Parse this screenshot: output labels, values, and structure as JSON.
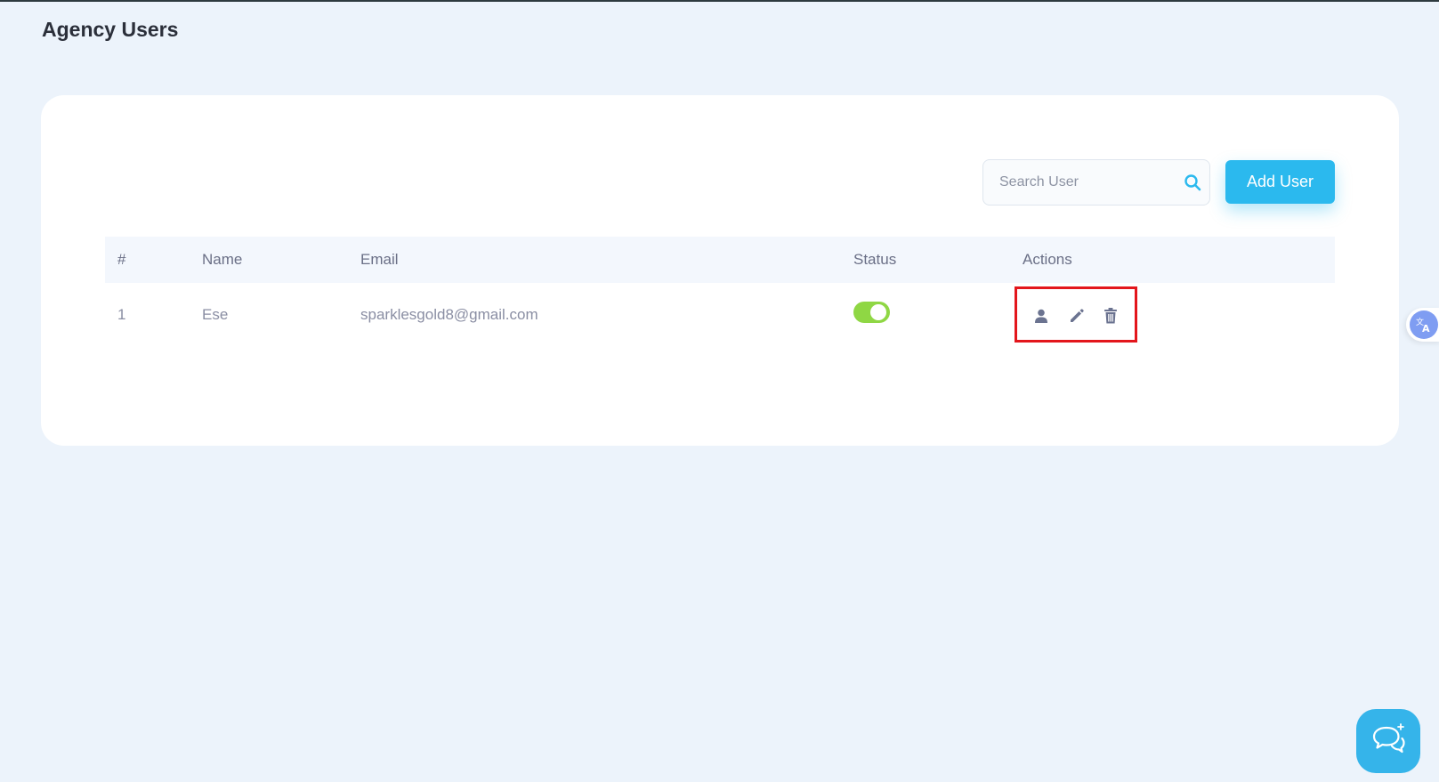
{
  "page": {
    "title": "Agency Users"
  },
  "search": {
    "placeholder": "Search User"
  },
  "toolbar": {
    "add_user_label": "Add User"
  },
  "table": {
    "columns": [
      "#",
      "Name",
      "Email",
      "Status",
      "Actions"
    ],
    "rows": [
      {
        "index": "1",
        "name": "Ese",
        "email": "sparklesgold8@gmail.com",
        "status_active": true
      }
    ]
  },
  "icons": {
    "search": "search-icon",
    "view": "user-icon",
    "edit": "pencil-icon",
    "delete": "trash-icon",
    "translate": "translate-icon",
    "chat": "chat-icon"
  },
  "colors": {
    "accent": "#2bb9ee",
    "toggle_on": "#8fd744",
    "highlight": "#e3161c",
    "background": "#ecf3fb"
  }
}
